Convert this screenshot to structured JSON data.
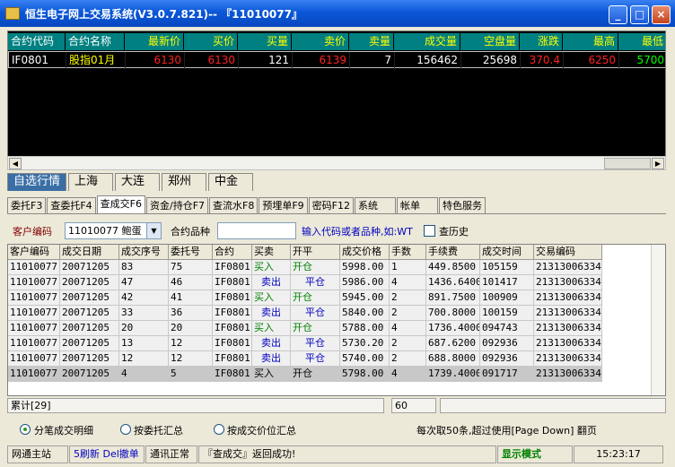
{
  "window": {
    "title": "恒生电子网上交易系统(V3.0.7.821)-- 『11010077』"
  },
  "quote": {
    "headers": [
      "合约代码",
      "合约名称",
      "最新价",
      "买价",
      "买量",
      "卖价",
      "卖量",
      "成交量",
      "空盘量",
      "涨跌",
      "最高",
      "最低"
    ],
    "row": [
      "IF0801",
      "股指01月",
      "6130",
      "6130",
      "121",
      "6139",
      "7",
      "156462",
      "25698",
      "370.4",
      "6250",
      "5700"
    ]
  },
  "market_tabs": [
    "自选行情",
    "上海",
    "大连",
    "郑州",
    "中金"
  ],
  "func_tabs": [
    "委托F3",
    "查委托F4",
    "查成交F6",
    "资金/持仓F7",
    "查流水F8",
    "预埋单F9",
    "密码F12",
    "系统",
    "帐单",
    "特色服务"
  ],
  "query": {
    "client_label": "客户编码",
    "client_value": "11010077 鲍蛋",
    "contract_label": "合约品种",
    "hint": "输入代码或者品种,如:WT",
    "history_label": "查历史"
  },
  "grid": {
    "headers": [
      "客户编码",
      "成交日期",
      "成交序号",
      "委托号",
      "合约",
      "买卖",
      "开平",
      "成交价格",
      "手数",
      "手续费",
      "成交时间",
      "交易编码"
    ],
    "rows": [
      [
        "11010077",
        "20071205",
        "83",
        "75",
        "IF0801",
        "买入",
        "开仓",
        "5998.00",
        "1",
        "449.8500",
        "105159",
        "21313006334"
      ],
      [
        "11010077",
        "20071205",
        "47",
        "46",
        "IF0801",
        "卖出",
        "平仓",
        "5986.00",
        "4",
        "1436.6400",
        "101417",
        "21313006334"
      ],
      [
        "11010077",
        "20071205",
        "42",
        "41",
        "IF0801",
        "买入",
        "开仓",
        "5945.00",
        "2",
        "891.7500",
        "100909",
        "21313006334"
      ],
      [
        "11010077",
        "20071205",
        "33",
        "36",
        "IF0801",
        "卖出",
        "平仓",
        "5840.00",
        "2",
        "700.8000",
        "100159",
        "21313006334"
      ],
      [
        "11010077",
        "20071205",
        "20",
        "20",
        "IF0801",
        "买入",
        "开仓",
        "5788.00",
        "4",
        "1736.4000",
        "094743",
        "21313006334"
      ],
      [
        "11010077",
        "20071205",
        "13",
        "12",
        "IF0801",
        "卖出",
        "平仓",
        "5730.20",
        "2",
        "687.6200",
        "092936",
        "21313006334"
      ],
      [
        "11010077",
        "20071205",
        "12",
        "12",
        "IF0801",
        "卖出",
        "平仓",
        "5740.00",
        "2",
        "688.8000",
        "092936",
        "21313006334"
      ],
      [
        "11010077",
        "20071205",
        "4",
        "5",
        "IF0801",
        "买入",
        "开仓",
        "5798.00",
        "4",
        "1739.4000",
        "091717",
        "21313006334"
      ]
    ]
  },
  "summary": {
    "total": "累计[29]",
    "lots": "60"
  },
  "options": {
    "radio1": "分笔成交明细",
    "radio2": "按委托汇总",
    "radio3": "按成交价位汇总",
    "note": "每次取50条,超过使用[Page Down] 翻页"
  },
  "status": {
    "site": "网通主站",
    "shortcut": "5刷新 Del撤单",
    "comm": "通讯正常",
    "message": "『查成交』返回成功!",
    "mode": "显示模式",
    "time": "15:23:17"
  },
  "colors": {
    "title_blue": "#0a57d8",
    "quote_bg": "#000000",
    "header_teal": "#008080",
    "buy_green": "#008000",
    "sell_blue": "#0000c0"
  }
}
